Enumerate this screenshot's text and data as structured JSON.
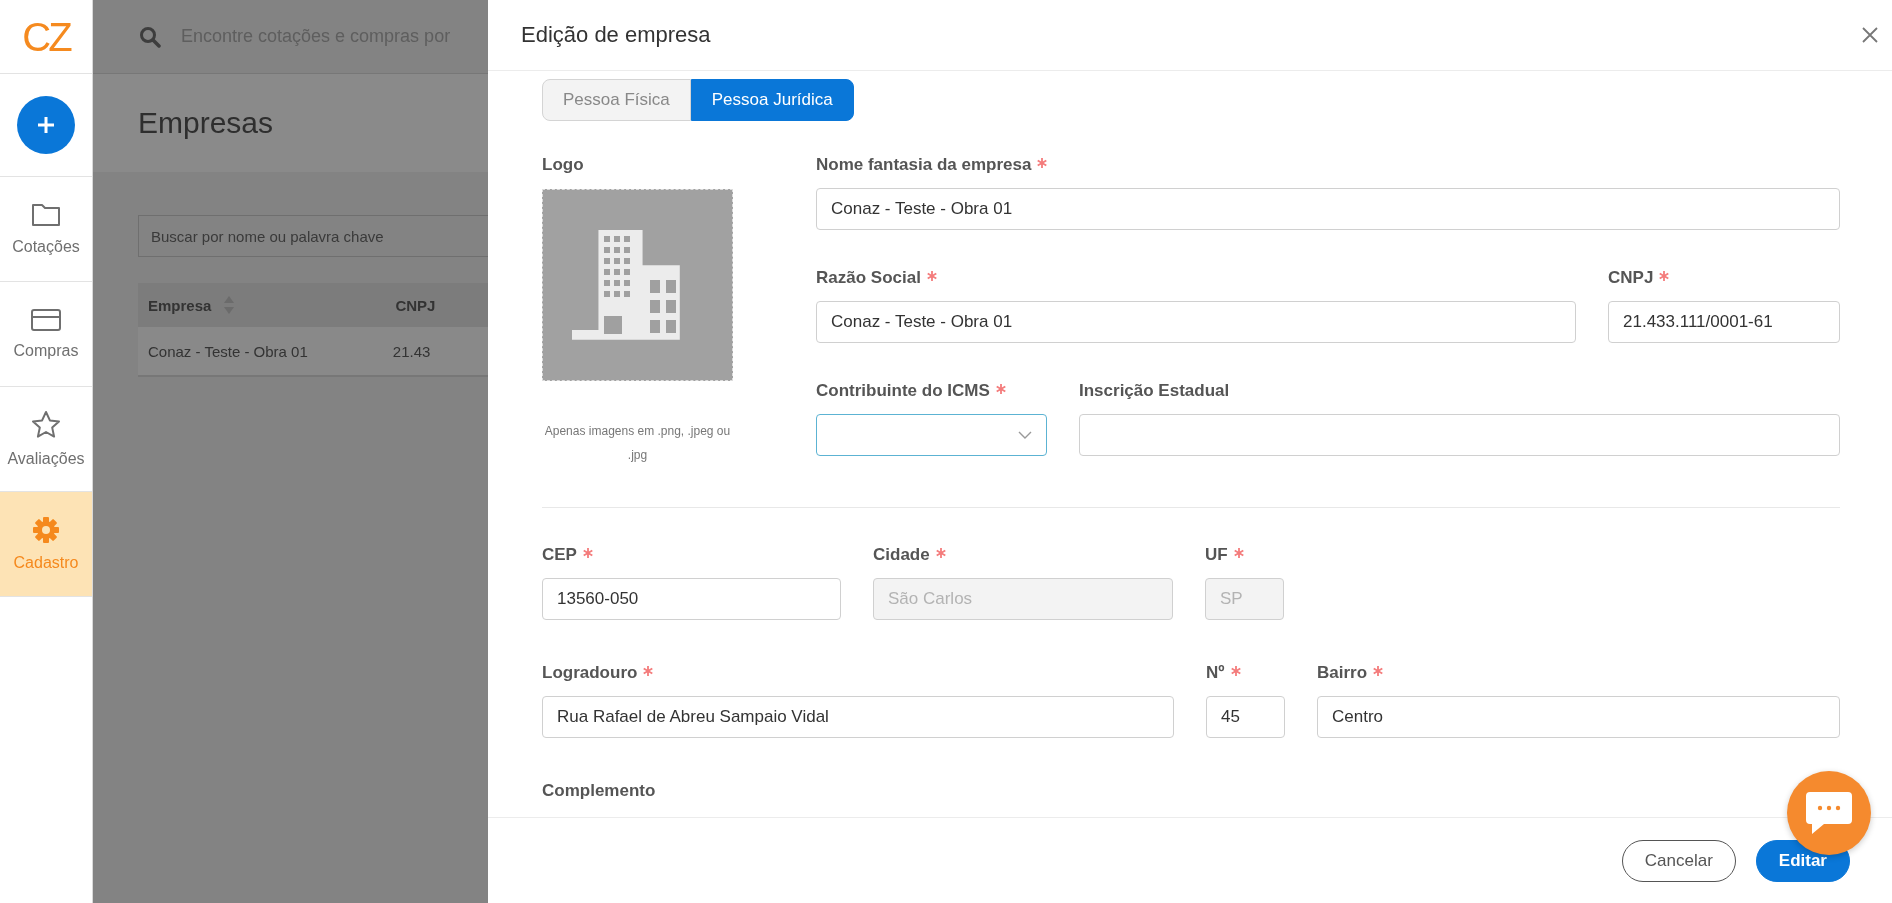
{
  "sidebar": {
    "logo": "CZ",
    "items": [
      {
        "label": "Cotações",
        "selected": false
      },
      {
        "label": "Compras",
        "selected": false
      },
      {
        "label": "Avaliações",
        "selected": false
      },
      {
        "label": "Cadastro",
        "selected": true
      }
    ]
  },
  "background": {
    "search_placeholder": "Encontre cotações e compras por",
    "title": "Empresas",
    "filter_placeholder": "Buscar por nome ou palavra chave",
    "table": {
      "columns": [
        "Empresa",
        "CNPJ"
      ],
      "rows": [
        [
          "Conaz - Teste - Obra 01",
          "21.43"
        ]
      ]
    }
  },
  "modal": {
    "title": "Edição de empresa",
    "tabs": [
      {
        "label": "Pessoa Física",
        "selected": false
      },
      {
        "label": "Pessoa Jurídica",
        "selected": true
      }
    ],
    "logo": {
      "label": "Logo",
      "hint": "Apenas imagens em .png, .jpeg ou .jpg"
    },
    "company_rows": [
      [
        {
          "label": "Nome fantasia da empresa",
          "required": true,
          "kind": "text",
          "value": "Conaz - Teste - Obra 01",
          "disabled": false,
          "focused": false
        }
      ],
      [
        {
          "label": "Razão Social",
          "required": true,
          "kind": "text",
          "value": "Conaz - Teste - Obra 01",
          "disabled": false,
          "focused": false
        },
        {
          "label": "CNPJ",
          "required": true,
          "kind": "text",
          "value": "21.433.111/0001-61",
          "disabled": false,
          "focused": false
        }
      ],
      [
        {
          "label": "Contribuinte do ICMS",
          "required": true,
          "kind": "select",
          "disabled": false,
          "focused": true
        },
        {
          "label": "Inscrição Estadual",
          "required": false,
          "kind": "text",
          "disabled": false,
          "focused": false
        }
      ]
    ],
    "address_rows": [
      [
        {
          "label": "CEP",
          "required": true,
          "kind": "text",
          "value": "13560-050",
          "disabled": false,
          "focused": false
        },
        {
          "label": "Cidade",
          "required": true,
          "kind": "text",
          "value": "São Carlos",
          "disabled": true,
          "focused": false
        },
        {
          "label": "UF",
          "required": true,
          "kind": "text",
          "value": "SP",
          "disabled": true,
          "focused": false
        }
      ],
      [
        {
          "label": "Logradouro",
          "required": true,
          "kind": "text",
          "value": "Rua Rafael de Abreu Sampaio Vidal",
          "disabled": false,
          "focused": false
        },
        {
          "label": "Nº",
          "required": true,
          "kind": "text",
          "value": "45",
          "disabled": false,
          "focused": false
        },
        {
          "label": "Bairro",
          "required": true,
          "kind": "text",
          "value": "Centro",
          "disabled": false,
          "focused": false
        }
      ],
      [
        {
          "label": "Complemento",
          "required": false,
          "kind": "label"
        }
      ]
    ],
    "buttons": [
      {
        "label": "Cancelar",
        "kind": "secondary"
      },
      {
        "label": "Editar",
        "kind": "primary"
      }
    ]
  }
}
